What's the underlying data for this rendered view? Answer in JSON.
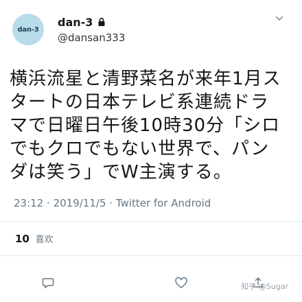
{
  "tweet": {
    "avatar_text": "dan-3",
    "display_name": "dan-3",
    "handle": "@dansan333",
    "body": "横浜流星と清野菜名が来年1月スタートの日本テレビ系連続ドラマで日曜日午後10時30分「シロでもクロでもない世界で、パンダは笑う」でW主演する。",
    "time": "23:12",
    "date": "2019/11/5",
    "separator": "·",
    "source": "Twitter for Android",
    "likes_count": "10",
    "likes_label": "喜欢",
    "watermark": "知乎 @Sugar"
  },
  "icons": {
    "lock": "lock-icon",
    "caret": "chevron-down-icon",
    "reply": "reply-icon",
    "like": "heart-icon",
    "share": "share-icon"
  },
  "colors": {
    "avatar_bg": "#b8dcea",
    "muted_text": "#657786",
    "divider": "#e1e8ed"
  }
}
